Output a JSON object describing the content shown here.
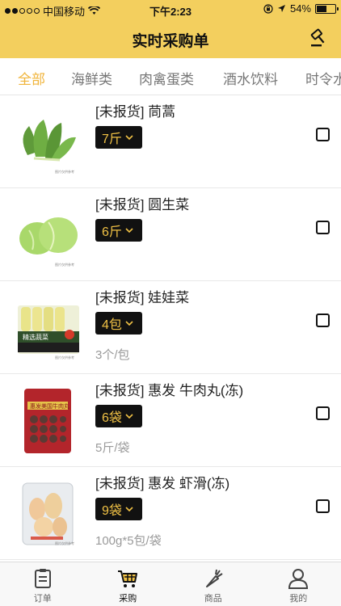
{
  "status_bar": {
    "carrier": "中国移动",
    "time": "下午2:23",
    "battery_text": "54%",
    "battery_level": 0.54
  },
  "header": {
    "title": "实时采购单",
    "action_icon": "gavel-icon"
  },
  "categories": [
    {
      "label": "全部",
      "active": true
    },
    {
      "label": "海鲜类",
      "active": false
    },
    {
      "label": "肉禽蛋类",
      "active": false
    },
    {
      "label": "酒水饮料",
      "active": false
    },
    {
      "label": "时令水",
      "active": false
    }
  ],
  "items": [
    {
      "name": "[未报货] 茼蒿",
      "quantity": "7斤",
      "spec": "",
      "image_caption": "图片仅供参考",
      "checked": false
    },
    {
      "name": "[未报货] 圆生菜",
      "quantity": "6斤",
      "spec": "",
      "image_caption": "图片仅供参考",
      "checked": false
    },
    {
      "name": "[未报货] 娃娃菜",
      "quantity": "4包",
      "spec": "3个/包",
      "image_caption": "图片仅供参考",
      "image_text": "精选蔬菜",
      "checked": false
    },
    {
      "name": "[未报货] 惠发 牛肉丸(冻)",
      "quantity": "6袋",
      "spec": "5斤/袋",
      "image_caption": "",
      "image_text": "惠发美国牛肉丸",
      "checked": false
    },
    {
      "name": "[未报货] 惠发 虾滑(冻)",
      "quantity": "9袋",
      "spec": "100g*5包/袋",
      "image_caption": "图片仅供参考",
      "checked": false
    }
  ],
  "tabbar": [
    {
      "label": "订单",
      "icon": "clipboard-icon",
      "active": false
    },
    {
      "label": "采购",
      "icon": "cart-icon",
      "active": true
    },
    {
      "label": "商品",
      "icon": "carrot-icon",
      "active": false
    },
    {
      "label": "我的",
      "icon": "user-icon",
      "active": false
    }
  ],
  "colors": {
    "accent": "#f3cf5e",
    "active_tab": "#f0b43a",
    "qty_bg": "#111111",
    "qty_text": "#f0c145"
  }
}
